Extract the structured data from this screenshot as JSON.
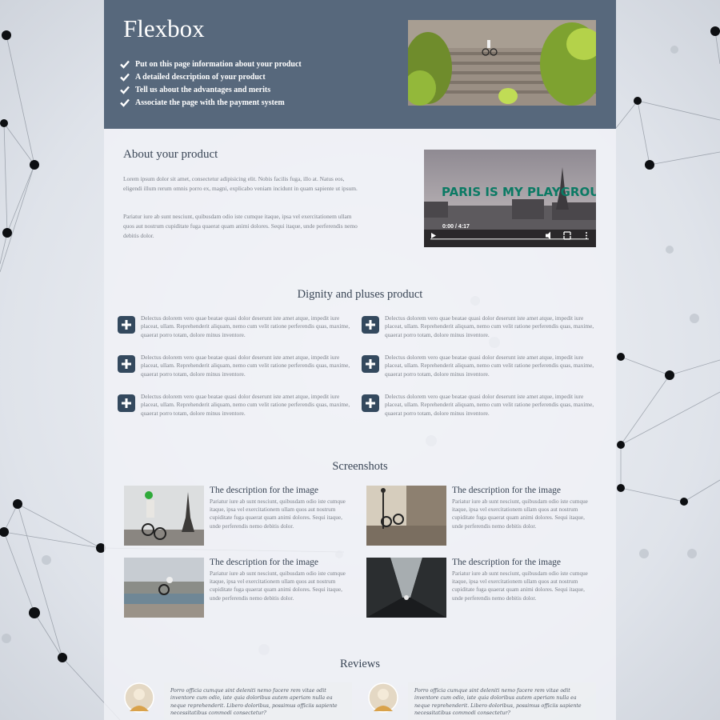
{
  "header": {
    "title": "Flexbox",
    "features": [
      "Put on this page information about your product",
      "A detailed description of your product",
      "Tell us about the advantages and merits",
      "Associate the page with the payment system"
    ]
  },
  "about": {
    "title": "About your product",
    "paragraphs": [
      "Lorem ipsum dolor sit amet, consectetur adipisicing elit. Nobis facilis fuga, illo at. Natus eos, eligendi illum rerum omnis porro ex, magni, explicabo veniam incidunt in quam sapiente ut ipsum.",
      "Pariatur iure ab sunt nesciunt, quibusdam odio iste cumque itaque, ipsa vel exercitationem ullam quos aut nostrum cupiditate fuga quaerat quam animi dolores. Sequi itaque, unde perferendis nemo debitis dolor."
    ],
    "video": {
      "poster_text": "PARIS IS MY PLAYGROUND",
      "time": "0:00 / 4:17"
    }
  },
  "dignity": {
    "title": "Dignity and pluses product",
    "items": [
      "Delectus dolorem vero quae beatae quasi dolor deserunt iste amet atque, impedit iure placeat, ullam. Reprehenderit aliquam, nemo cum velit ratione perferendis quas, maxime, quaerat porro totam, dolore minus inventore.",
      "Delectus dolorem vero quae beatae quasi dolor deserunt iste amet atque, impedit iure placeat, ullam. Reprehenderit aliquam, nemo cum velit ratione perferendis quas, maxime, quaerat porro totam, dolore minus inventore.",
      "Delectus dolorem vero quae beatae quasi dolor deserunt iste amet atque, impedit iure placeat, ullam. Reprehenderit aliquam, nemo cum velit ratione perferendis quas, maxime, quaerat porro totam, dolore minus inventore.",
      "Delectus dolorem vero quae beatae quasi dolor deserunt iste amet atque, impedit iure placeat, ullam. Reprehenderit aliquam, nemo cum velit ratione perferendis quas, maxime, quaerat porro totam, dolore minus inventore.",
      "Delectus dolorem vero quae beatae quasi dolor deserunt iste amet atque, impedit iure placeat, ullam. Reprehenderit aliquam, nemo cum velit ratione perferendis quas, maxime, quaerat porro totam, dolore minus inventore.",
      "Delectus dolorem vero quae beatae quasi dolor deserunt iste amet atque, impedit iure placeat, ullam. Reprehenderit aliquam, nemo cum velit ratione perferendis quas, maxime, quaerat porro totam, dolore minus inventore."
    ]
  },
  "screenshots": {
    "title": "Screenshots",
    "items": [
      {
        "title": "The description for the image",
        "text": "Pariatur iure ab sunt nesciunt, quibusdam odio iste cumque itaque, ipsa vel exercitationem ullam quos aut nostrum cupiditate fuga quaerat quam animi dolores. Sequi itaque, unde perferendis nemo debitis dolor."
      },
      {
        "title": "The description for the image",
        "text": "Pariatur iure ab sunt nesciunt, quibusdam odio iste cumque itaque, ipsa vel exercitationem ullam quos aut nostrum cupiditate fuga quaerat quam animi dolores. Sequi itaque, unde perferendis nemo debitis dolor."
      },
      {
        "title": "The description for the image",
        "text": "Pariatur iure ab sunt nesciunt, quibusdam odio iste cumque itaque, ipsa vel exercitationem ullam quos aut nostrum cupiditate fuga quaerat quam animi dolores. Sequi itaque, unde perferendis nemo debitis dolor."
      },
      {
        "title": "The description for the image",
        "text": "Pariatur iure ab sunt nesciunt, quibusdam odio iste cumque itaque, ipsa vel exercitationem ullam quos aut nostrum cupiditate fuga quaerat quam animi dolores. Sequi itaque, unde perferendis nemo debitis dolor."
      }
    ]
  },
  "reviews": {
    "title": "Reviews",
    "items": [
      "Porro officia cumque sint deleniti nemo facere rem vitae odit inventore cum odio, iste quia doloribus autem aperiam nulla ea neque reprehenderit. Libero doloribus, possimus officiis sapiente necessitatibus commodi consectetur?",
      "Porro officia cumque sint deleniti nemo facere rem vitae odit inventore cum odio, iste quia doloribus autem aperiam nulla ea neque reprehenderit. Libero doloribus, possimus officiis sapiente necessitatibus commodi consectetur?"
    ]
  },
  "colors": {
    "header_bg": "#57687c",
    "accent_dark": "#34495e",
    "heading": "#3a4656",
    "body_text": "#7a7f88"
  }
}
